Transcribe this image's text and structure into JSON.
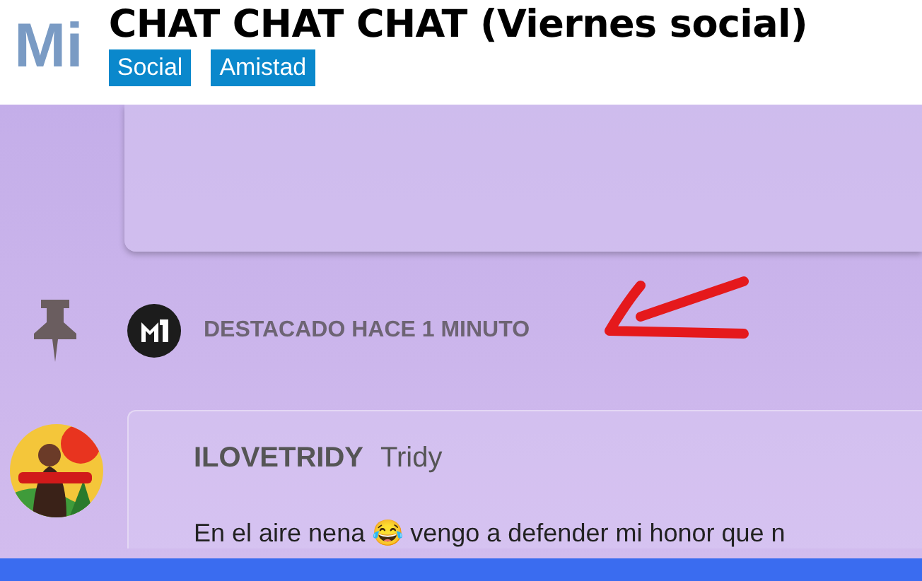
{
  "header": {
    "logo": "Mi",
    "title": "CHAT CHAT CHAT (Viernes social)",
    "tags": [
      "Social",
      "Amistad"
    ]
  },
  "pinned": {
    "text": "DESTACADO HACE 1 MINUTO"
  },
  "message": {
    "username": "ILOVETRIDY",
    "nickname": "Tridy",
    "text": "En el aire nena 😂 vengo a defender mi honor que n"
  }
}
